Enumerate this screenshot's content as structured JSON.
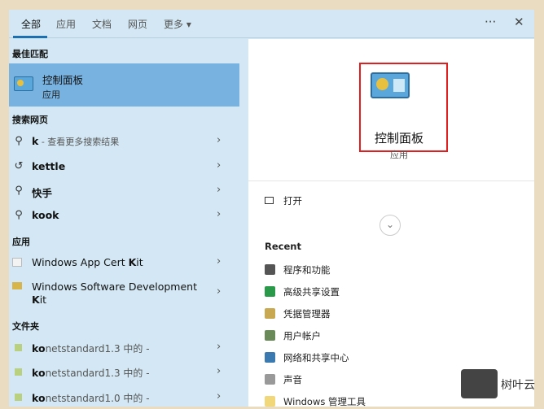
{
  "tabs": [
    {
      "label": "全部"
    },
    {
      "label": "应用"
    },
    {
      "label": "文档"
    },
    {
      "label": "网页"
    },
    {
      "label": "更多 ▾"
    }
  ],
  "toolbar": {
    "more": "···",
    "close": "✕"
  },
  "left": {
    "best_match_header": "最佳匹配",
    "best_match": {
      "title": "控制面板",
      "subtitle": "应用"
    },
    "web_header": "搜索网页",
    "web": [
      {
        "bold": "k",
        "rest": " - 查看更多搜索结果",
        "icon": "search-icon"
      },
      {
        "bold": "kettle",
        "rest": "",
        "icon": "history-icon"
      },
      {
        "bold": "快手",
        "rest": "",
        "icon": "search-icon"
      },
      {
        "bold": "kook",
        "rest": "",
        "icon": "search-icon"
      }
    ],
    "apps_header": "应用",
    "apps": [
      {
        "pre": "Windows App Cert ",
        "bold": "K",
        "post": "it"
      },
      {
        "line1": "Windows Software Development",
        "bold2": "K",
        "post2": "it"
      }
    ],
    "folders_header": "文件夹",
    "folders": [
      {
        "bold": "ko",
        "rest": "netstandard1.3 中的 -"
      },
      {
        "bold": "ko",
        "rest": "netstandard1.3 中的 -"
      },
      {
        "bold": "ko",
        "rest": "netstandard1.0 中的 -"
      }
    ]
  },
  "right": {
    "title": "控制面板",
    "subtitle": "应用",
    "open": "打开",
    "recent_header": "Recent",
    "recent": [
      {
        "label": "程序和功能",
        "color": "#555"
      },
      {
        "label": "高级共享设置",
        "color": "#2a9a4a"
      },
      {
        "label": "凭据管理器",
        "color": "#c8a850"
      },
      {
        "label": "用户帐户",
        "color": "#6a8a5a"
      },
      {
        "label": "网络和共享中心",
        "color": "#3a7ab0"
      },
      {
        "label": "声音",
        "color": "#999"
      },
      {
        "label": "Windows 管理工具",
        "color": "#f2d67a"
      }
    ]
  },
  "watermark": {
    "logo": "AI",
    "text": "树叶云"
  }
}
